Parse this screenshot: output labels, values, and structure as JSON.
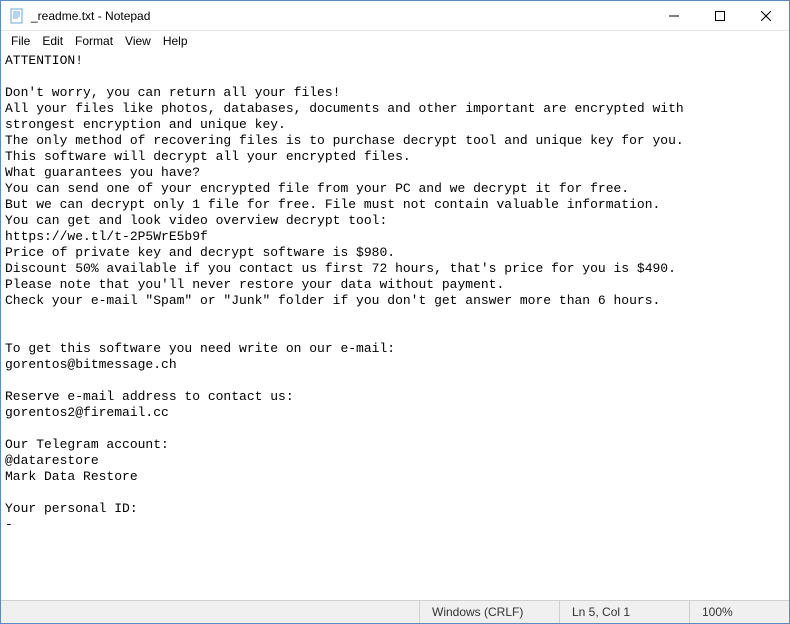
{
  "window": {
    "title": "_readme.txt - Notepad"
  },
  "menu": {
    "file": "File",
    "edit": "Edit",
    "format": "Format",
    "view": "View",
    "help": "Help"
  },
  "editor": {
    "content": "ATTENTION!\n\nDon't worry, you can return all your files!\nAll your files like photos, databases, documents and other important are encrypted with\nstrongest encryption and unique key.\nThe only method of recovering files is to purchase decrypt tool and unique key for you.\nThis software will decrypt all your encrypted files.\nWhat guarantees you have?\nYou can send one of your encrypted file from your PC and we decrypt it for free.\nBut we can decrypt only 1 file for free. File must not contain valuable information.\nYou can get and look video overview decrypt tool:\nhttps://we.tl/t-2P5WrE5b9f\nPrice of private key and decrypt software is $980.\nDiscount 50% available if you contact us first 72 hours, that's price for you is $490.\nPlease note that you'll never restore your data without payment.\nCheck your e-mail \"Spam\" or \"Junk\" folder if you don't get answer more than 6 hours.\n\n\nTo get this software you need write on our e-mail:\ngorentos@bitmessage.ch\n\nReserve e-mail address to contact us:\ngorentos2@firemail.cc\n\nOur Telegram account:\n@datarestore\nMark Data Restore\n\nYour personal ID:\n-"
  },
  "statusbar": {
    "encoding": "Windows (CRLF)",
    "position": "Ln 5, Col 1",
    "zoom": "100%"
  }
}
